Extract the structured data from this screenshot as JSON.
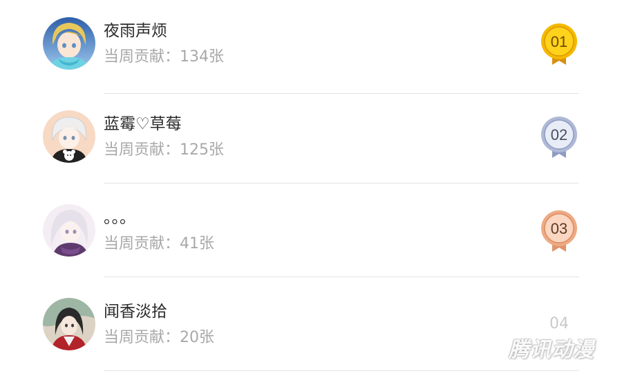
{
  "contributors": [
    {
      "name": "夜雨声烦",
      "contribution": "当周贡献：134张",
      "rank": "01",
      "medal": "gold"
    },
    {
      "name": "蓝霉♡草莓",
      "contribution": "当周贡献：125张",
      "rank": "02",
      "medal": "silver"
    },
    {
      "name": "。。。",
      "contribution": "当周贡献：41张",
      "rank": "03",
      "medal": "bronze"
    },
    {
      "name": "闻香淡拾",
      "contribution": "当周贡献：20张",
      "rank": "04",
      "medal": "none"
    }
  ],
  "colors": {
    "gold": "#f5b800",
    "silver": "#9aa7c7",
    "bronze": "#e8a07a",
    "separator": "#e2e2e2"
  },
  "watermark": "腾讯动漫"
}
